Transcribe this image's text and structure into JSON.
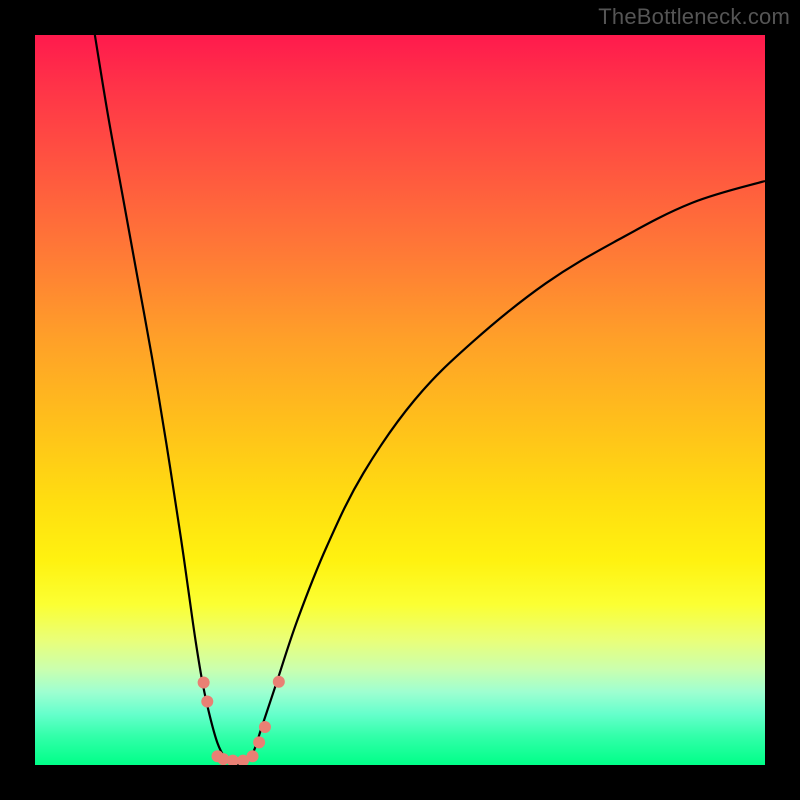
{
  "watermark": "TheBottleneck.com",
  "chart_data": {
    "type": "line",
    "title": "",
    "xlabel": "",
    "ylabel": "",
    "xlim": [
      0,
      100
    ],
    "ylim": [
      0,
      100
    ],
    "grid": false,
    "legend": false,
    "series": [
      {
        "name": "left-branch",
        "x": [
          8.2,
          10,
          12,
          14,
          16,
          18,
          20,
          21,
          22,
          23,
          24,
          25,
          26,
          27,
          28
        ],
        "y": [
          100,
          89,
          78,
          67,
          56,
          44,
          31,
          24,
          17,
          11,
          6.5,
          3,
          1,
          0,
          0
        ]
      },
      {
        "name": "right-branch",
        "x": [
          28,
          29,
          30,
          31,
          33,
          36,
          40,
          45,
          52,
          60,
          70,
          80,
          90,
          100
        ],
        "y": [
          0,
          0.5,
          2,
          5,
          11,
          20,
          30,
          40,
          50,
          58,
          66,
          72,
          77,
          80
        ]
      }
    ],
    "markers": [
      {
        "x": 23.1,
        "y": 11.3,
        "r": 6
      },
      {
        "x": 23.6,
        "y": 8.7,
        "r": 6
      },
      {
        "x": 25.0,
        "y": 1.2,
        "r": 6
      },
      {
        "x": 25.8,
        "y": 0.8,
        "r": 6
      },
      {
        "x": 27.1,
        "y": 0.6,
        "r": 6
      },
      {
        "x": 28.5,
        "y": 0.6,
        "r": 6
      },
      {
        "x": 29.8,
        "y": 1.2,
        "r": 6
      },
      {
        "x": 30.7,
        "y": 3.1,
        "r": 6
      },
      {
        "x": 31.5,
        "y": 5.2,
        "r": 6
      },
      {
        "x": 33.4,
        "y": 11.4,
        "r": 6
      }
    ],
    "marker_color": "#e98074",
    "curve_color": "#000000",
    "curve_width": 2.2
  }
}
